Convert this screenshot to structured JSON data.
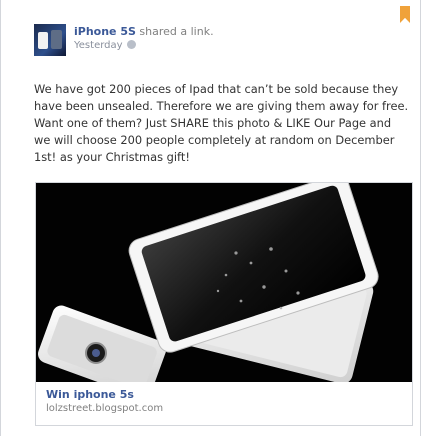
{
  "post": {
    "author": "iPhone 5S",
    "action": "shared a link.",
    "timestamp": "Yesterday",
    "message": "We have got 200 pieces of Ipad that can’t be sold because they\nhave been unsealed. Therefore we are giving them away for free.\nWant one of them? Just SHARE this photo & LIKE Our Page and\nwe will choose 200 people completely at random on December\n1st! as your Christmas gift!"
  },
  "link": {
    "title": "Win iphone 5s",
    "domain": "lolzstreet.blogspot.com"
  },
  "icons": {
    "bookmark": "bookmark-icon",
    "privacy": "globe-icon"
  },
  "colors": {
    "link_blue": "#3b5998",
    "bookmark_orange": "#f0a23a",
    "photo_bg": "#020202"
  }
}
